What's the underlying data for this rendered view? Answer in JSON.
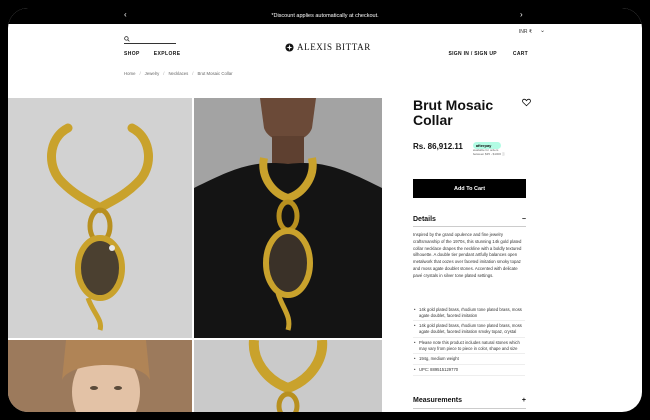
{
  "announcement": {
    "text": "*Discount applies automatically at checkout.",
    "prev_icon": "chevron-left-icon",
    "next_icon": "chevron-right-icon"
  },
  "header": {
    "currency": "INR ₹",
    "logo": "ALEXIS BITTAR",
    "nav": [
      "SHOP",
      "EXPLORE"
    ],
    "account": "SIGN IN / SIGN UP",
    "cart": "CART"
  },
  "breadcrumb": [
    "Home",
    "Jewelry",
    "Necklaces",
    "Brut Mosaic Collar"
  ],
  "product": {
    "title": "Brut Mosaic Collar",
    "price": "Rs. 86,912.11",
    "afterpay": {
      "badge": "afterpay",
      "line1": "available for orders",
      "line2": "between $35 - $1000 ⓘ"
    },
    "add_to_cart": "Add To Cart",
    "details_label": "Details",
    "details_toggle": "−",
    "description": "Inspired by the grand opulence and fine jewelry craftsmanship of the 1970s, this stunning 14k gold plated collar necklace drapes the neckline with a boldly textured silhouette. A double tier pendant artfully balances open metalwork that oozes over faceted imitation smoky topaz and moss agate doublet stones. Accented with delicate pavé crystals in silver tone plated settings.",
    "bullets": [
      "14k gold plated brass, rhodium tone plated brass, moss agate doublet, faceted imitation",
      "14k gold plated brass, rhodium tone plated brass, moss agate doublet, faceted imitation smoky topaz, crystal",
      "Please note this product includes natural stones which may vary from piece to piece in color, shape and size",
      "194g, medium weight",
      "UPC: 889515129770"
    ],
    "measurements_label": "Measurements",
    "measurements_toggle": "+"
  },
  "colors": {
    "gold": "#c9a22c",
    "afterpay_mint": "#b2fce4",
    "button": "#000000"
  }
}
